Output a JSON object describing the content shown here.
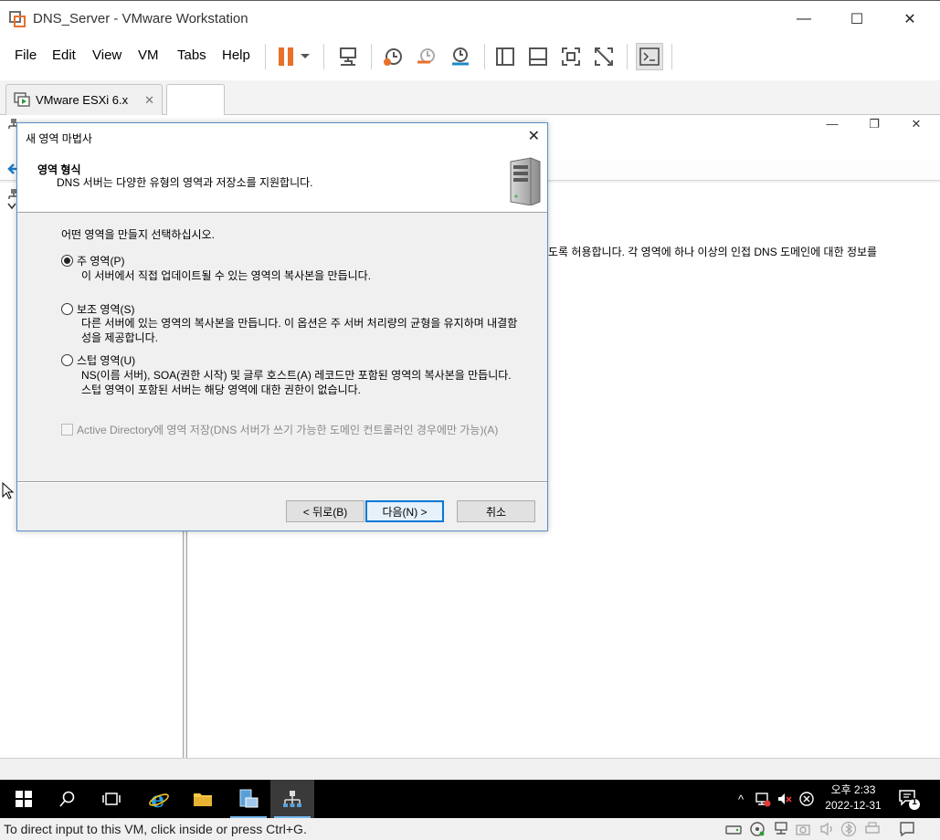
{
  "window": {
    "title": "DNS_Server - VMware Workstation",
    "minimize": "—",
    "maximize": "☐",
    "close": "✕"
  },
  "menu": {
    "items": [
      "File",
      "Edit",
      "View",
      "VM",
      "Tabs",
      "Help"
    ]
  },
  "tabs": {
    "items": [
      {
        "label": "VMware ESXi 6.x",
        "close": "✕"
      },
      {
        "label": ""
      }
    ]
  },
  "mmc": {
    "right_text": "도록 허용합니다. 각 영역에 하나 이상의 인접 DNS 도메인에 대한 정보를"
  },
  "dialog": {
    "title": "새 영역 마법사",
    "close": "✕",
    "header_title": "영역 형식",
    "header_subtitle": "DNS 서버는 다양한 유형의 영역과 저장소를 지원합니다.",
    "prompt": "어떤 영역을 만들지 선택하십시오.",
    "options": [
      {
        "label": "주 영역(P)",
        "desc": "이 서버에서 직접 업데이트될 수 있는 영역의 복사본을 만듭니다.",
        "selected": true
      },
      {
        "label": "보조 영역(S)",
        "desc": "다른 서버에 있는 영역의 복사본을 만듭니다. 이 옵션은 주 서버 처리량의 균형을 유지하며 내결함성을 제공합니다.",
        "selected": false
      },
      {
        "label": "스텁 영역(U)",
        "desc": "NS(이름 서버), SOA(권한 시작) 및 글루 호스트(A) 레코드만 포함된 영역의 복사본을 만듭니다. 스텁 영역이 포함된 서버는 해당 영역에 대한 권한이 없습니다.",
        "selected": false
      }
    ],
    "checkbox_label": "Active Directory에 영역 저장(DNS 서버가 쓰기 가능한 도메인 컨트롤러인 경우에만 가능)(A)",
    "buttons": {
      "back": "< 뒤로(B)",
      "next": "다음(N) >",
      "cancel": "취소"
    }
  },
  "taskbar": {
    "clock_time": "오후 2:33",
    "clock_date": "2022-12-31",
    "notification_count": "1"
  },
  "statusbar": {
    "text": "To direct input to this VM, click inside or press Ctrl+G."
  },
  "colors": {
    "accent": "#0078d7",
    "pause_orange": "#e8702a",
    "taskbar": "#000000"
  }
}
